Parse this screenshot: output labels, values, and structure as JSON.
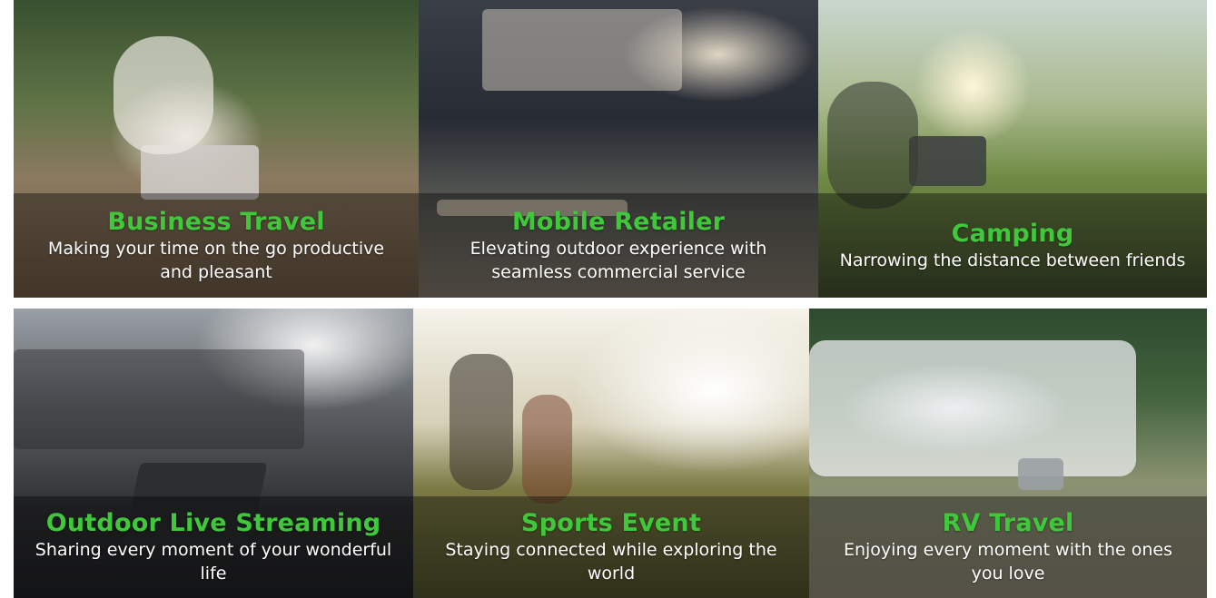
{
  "cards": [
    {
      "title": "Business Travel",
      "desc": "Making your time on the go productive and pleasant"
    },
    {
      "title": "Mobile Retailer",
      "desc": "Elevating outdoor experience with seamless commercial service"
    },
    {
      "title": "Camping",
      "desc": "Narrowing the distance between friends"
    },
    {
      "title": "Outdoor Live Streaming",
      "desc": "Sharing every moment of your wonderful life"
    },
    {
      "title": "Sports Event",
      "desc": "Staying connected while exploring the world"
    },
    {
      "title": "RV Travel",
      "desc": "Enjoying every moment with the ones you love"
    }
  ],
  "colors": {
    "title_green": "#3fc83a",
    "desc_white": "#ffffff",
    "overlay": "rgba(0,0,0,0.38)"
  }
}
